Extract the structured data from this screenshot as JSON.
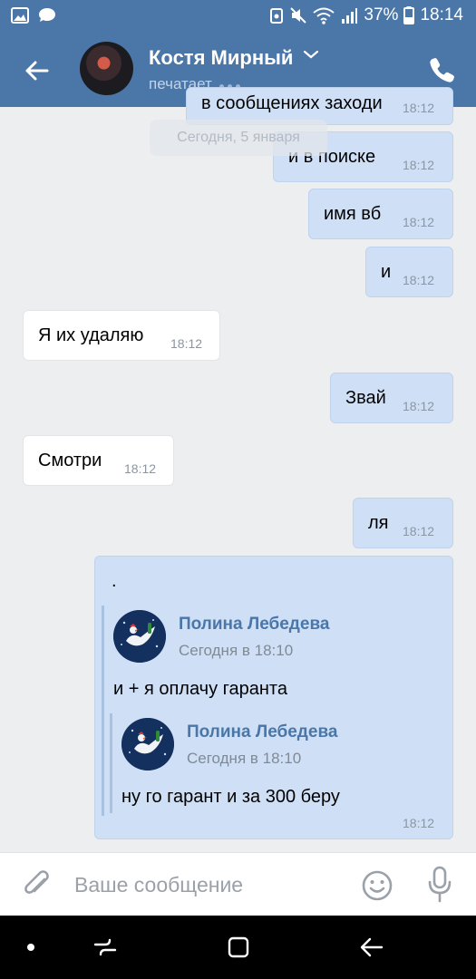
{
  "status_bar": {
    "battery": "37%",
    "time": "18:14"
  },
  "header": {
    "contact_name": "Костя Мирный",
    "status": "печатает"
  },
  "date_separator": "Сегодня, 5 января",
  "partial_top_message": {
    "text": "в сообщениях заходи",
    "time": "18:12"
  },
  "messages": [
    {
      "direction": "out",
      "text": "и в поиске",
      "time": "18:12"
    },
    {
      "direction": "out",
      "text": "имя вб",
      "time": "18:12"
    },
    {
      "direction": "out",
      "text": "и",
      "time": "18:12"
    },
    {
      "direction": "in",
      "text": "Я их удаляю",
      "time": "18:12"
    },
    {
      "direction": "out",
      "text": "Звай",
      "time": "18:12"
    },
    {
      "direction": "in",
      "text": "Смотри",
      "time": "18:12"
    },
    {
      "direction": "out",
      "text": "ля",
      "time": "18:12"
    }
  ],
  "forwarded_message": {
    "text": ".",
    "time": "18:12",
    "outer": {
      "author": "Полина Лебедева",
      "date": "Сегодня в 18:10",
      "text": "и + я оплачу гаранта"
    },
    "inner": {
      "author": "Полина Лебедева",
      "date": "Сегодня в 18:10",
      "text": "ну го гарант и за 300 беру"
    }
  },
  "composer": {
    "placeholder": "Ваше сообщение"
  },
  "colors": {
    "header": "#4a76a8",
    "outgoing_bubble": "#cfe0f6",
    "incoming_bubble": "#ffffff",
    "link": "#4a76a8"
  }
}
